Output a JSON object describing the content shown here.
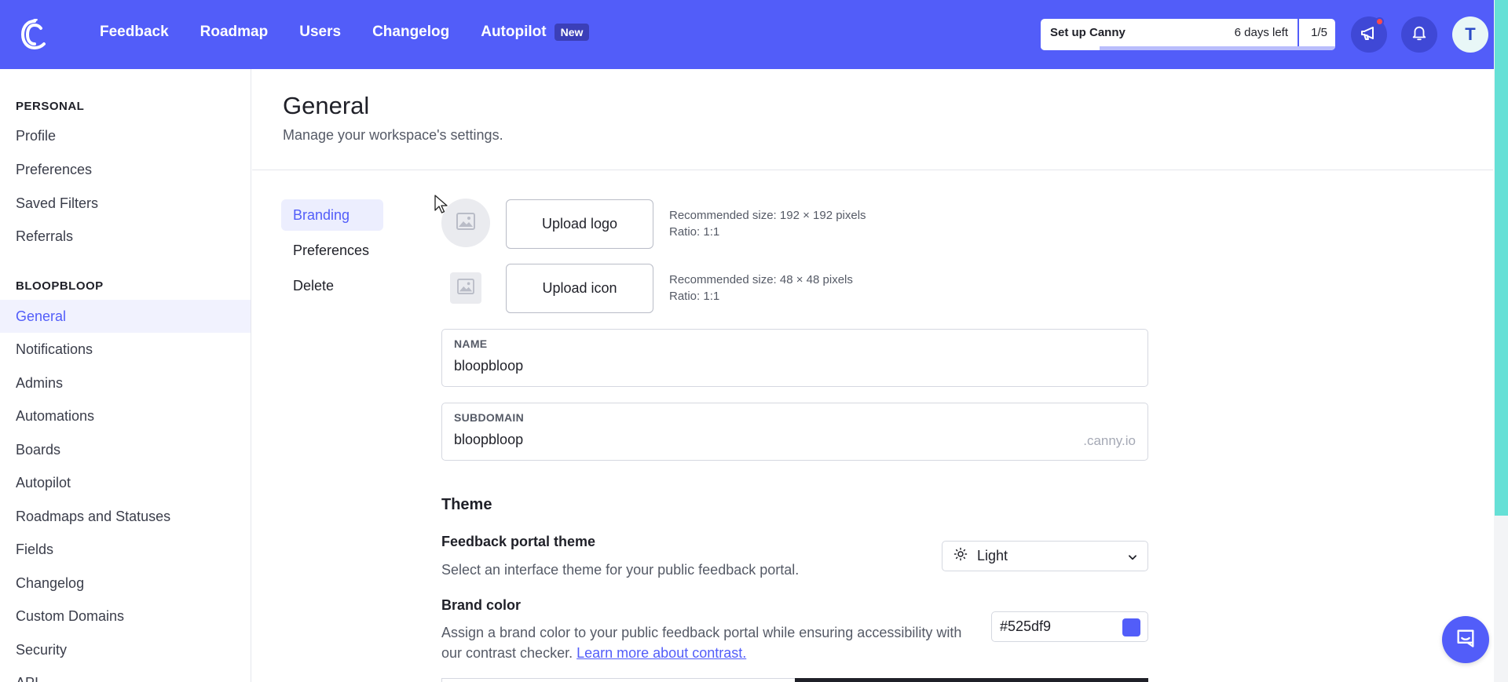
{
  "nav": {
    "links": [
      "Feedback",
      "Roadmap",
      "Users",
      "Changelog"
    ],
    "autopilot_label": "Autopilot",
    "new_badge": "New",
    "logo_icon": "canny-logo-icon",
    "announcements_icon": "megaphone-icon",
    "notifications_icon": "bell-icon",
    "avatar_initial": "T",
    "colors": {
      "brand": "#525df9"
    }
  },
  "setup": {
    "title": "Set up Canny",
    "days_left": "6 days left",
    "progress": "1/5",
    "progress_fraction": 0.2
  },
  "sidebar": {
    "personal_heading": "PERSONAL",
    "personal_items": [
      "Profile",
      "Preferences",
      "Saved Filters",
      "Referrals"
    ],
    "workspace_heading": "BLOOPBLOOP",
    "workspace_items": [
      "General",
      "Notifications",
      "Admins",
      "Automations",
      "Boards",
      "Autopilot",
      "Roadmaps and Statuses",
      "Fields",
      "Changelog",
      "Custom Domains",
      "Security",
      "API"
    ],
    "active_item": "General"
  },
  "page": {
    "title": "General",
    "subtitle": "Manage your workspace's settings."
  },
  "subnav": {
    "items": [
      "Branding",
      "Preferences",
      "Delete"
    ],
    "active": "Branding"
  },
  "branding": {
    "upload_logo_label": "Upload logo",
    "logo_rec_size": "Recommended size: 192 × 192 pixels",
    "logo_rec_ratio": "Ratio: 1:1",
    "upload_icon_label": "Upload icon",
    "icon_rec_size": "Recommended size: 48 × 48 pixels",
    "icon_rec_ratio": "Ratio: 1:1",
    "placeholder_icon": "image-placeholder-icon"
  },
  "fields": {
    "name_label": "NAME",
    "name_value": "bloopbloop",
    "subdomain_label": "SUBDOMAIN",
    "subdomain_value": "bloopbloop",
    "subdomain_suffix": ".canny.io"
  },
  "theme": {
    "heading": "Theme",
    "portal_theme_title": "Feedback portal theme",
    "portal_theme_desc": "Select an interface theme for your public feedback portal.",
    "portal_theme_value": "Light",
    "portal_theme_icon": "sun-icon",
    "brand_color_title": "Brand color",
    "brand_color_desc": "Assign a brand color to your public feedback portal while ensuring accessibility with our contrast checker.",
    "brand_color_link": "Learn more about contrast.",
    "brand_color_value": "#525df9"
  },
  "chat_icon": "chat-icon"
}
